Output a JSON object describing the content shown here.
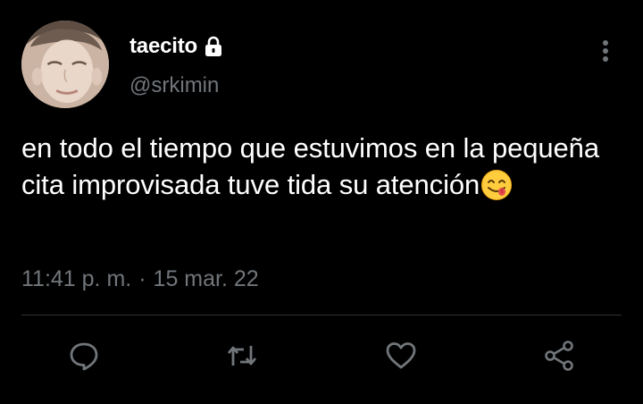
{
  "tweet": {
    "display_name": "taecito",
    "handle": "@srkimin",
    "body": "en todo el tiempo que estuvimos en la pequeña cita improvisada tuve tida su atención",
    "emoji": "face-savoring-food-emoji",
    "time": "11:41 p. m.",
    "separator": "·",
    "date": "15 mar. 22"
  },
  "icons": {
    "lock": "lock-icon",
    "more": "more-vertical-icon",
    "reply": "reply-icon",
    "retweet": "retweet-icon",
    "like": "heart-icon",
    "share": "share-icon"
  },
  "colors": {
    "background": "#000000",
    "text_primary": "#ffffff",
    "text_secondary": "#71767b",
    "divider": "#2f3336"
  }
}
